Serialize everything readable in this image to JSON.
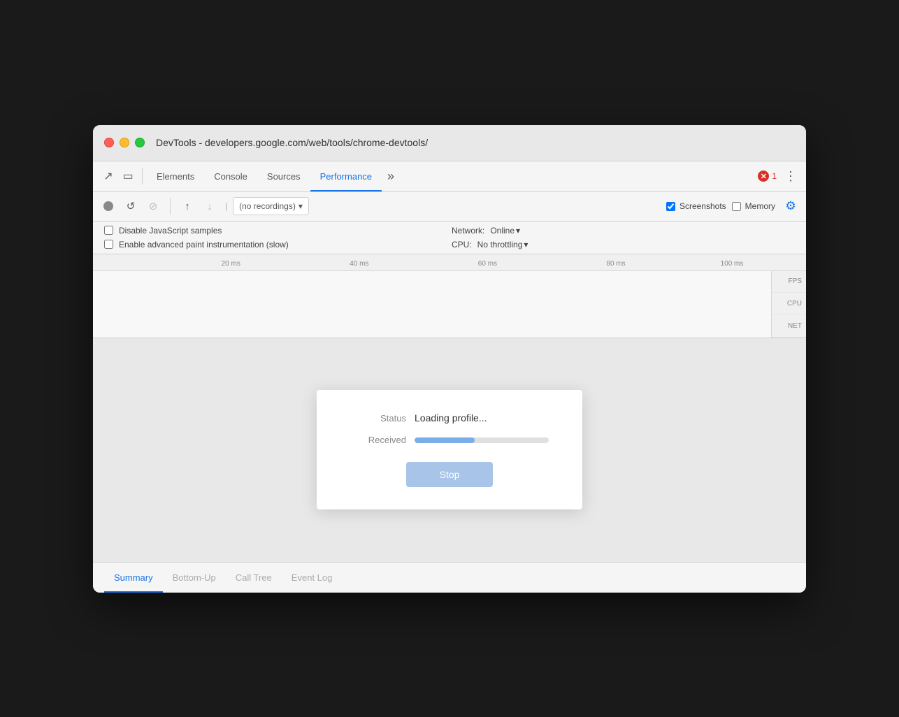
{
  "window": {
    "title": "DevTools - developers.google.com/web/tools/chrome-devtools/"
  },
  "tabs": {
    "items": [
      {
        "label": "Elements",
        "active": false
      },
      {
        "label": "Console",
        "active": false
      },
      {
        "label": "Sources",
        "active": false
      },
      {
        "label": "Performance",
        "active": true
      }
    ],
    "more_label": "»",
    "error_count": "1"
  },
  "toolbar": {
    "record_title": "Record",
    "reload_title": "Reload and record",
    "clear_title": "Clear recording",
    "upload_title": "Load profile",
    "download_title": "Save profile",
    "recordings_placeholder": "(no recordings)",
    "screenshots_label": "Screenshots",
    "memory_label": "Memory",
    "gear_title": "Capture settings"
  },
  "settings": {
    "disable_js_label": "Disable JavaScript samples",
    "paint_label": "Enable advanced paint instrumentation (slow)",
    "network_label": "Network:",
    "network_value": "Online",
    "cpu_label": "CPU:",
    "cpu_value": "No throttling"
  },
  "timeline": {
    "ticks": [
      "20 ms",
      "40 ms",
      "60 ms",
      "80 ms",
      "100 ms"
    ],
    "track_labels": [
      "FPS",
      "CPU",
      "NET"
    ]
  },
  "dialog": {
    "status_key": "Status",
    "status_value": "Loading profile...",
    "received_key": "Received",
    "progress_percent": 45,
    "stop_label": "Stop"
  },
  "bottom_tabs": {
    "items": [
      {
        "label": "Summary",
        "active": true
      },
      {
        "label": "Bottom-Up",
        "active": false
      },
      {
        "label": "Call Tree",
        "active": false
      },
      {
        "label": "Event Log",
        "active": false
      }
    ]
  },
  "icons": {
    "cursor": "↖",
    "mobile": "▭",
    "upload": "↑",
    "download": "↓",
    "reload": "↺",
    "ban": "⊘",
    "chevron_down": "▾",
    "more_vert": "⋮",
    "gear": "⚙"
  }
}
